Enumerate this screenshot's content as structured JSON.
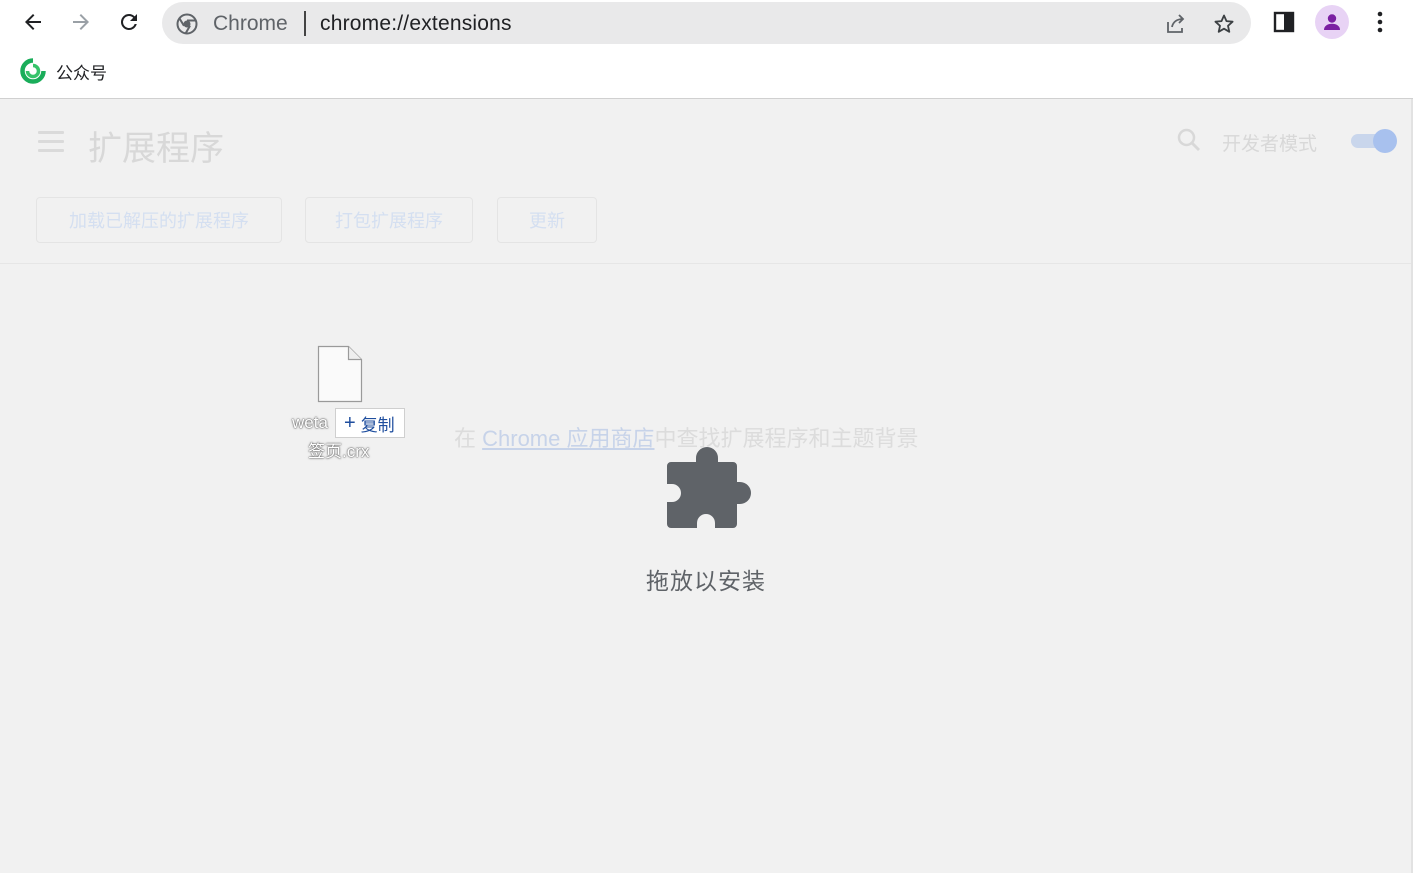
{
  "browser": {
    "site_label": "Chrome",
    "url": "chrome://extensions"
  },
  "bookmarks": {
    "items": [
      {
        "label": "公众号",
        "icon": "wechat-mp-icon"
      }
    ]
  },
  "extensions": {
    "title": "扩展程序",
    "dev_mode_label": "开发者模式",
    "dev_mode_on": true,
    "buttons": {
      "load_unpacked": "加载已解压的扩展程序",
      "pack": "打包扩展程序",
      "update": "更新"
    },
    "store_prefix": "在 ",
    "store_link": "Chrome 应用商店",
    "store_suffix": "中查找扩展程序和主题背景",
    "drop_label": "拖放以安装"
  },
  "drag": {
    "file_name_line1": "weta",
    "file_name_line2": "签页.crx",
    "copy_label": "复制",
    "copy_plus": "+"
  },
  "colors": {
    "accent": "#1a73e8",
    "puzzle": "#5f6368",
    "avatar": "#7b1fa2"
  }
}
